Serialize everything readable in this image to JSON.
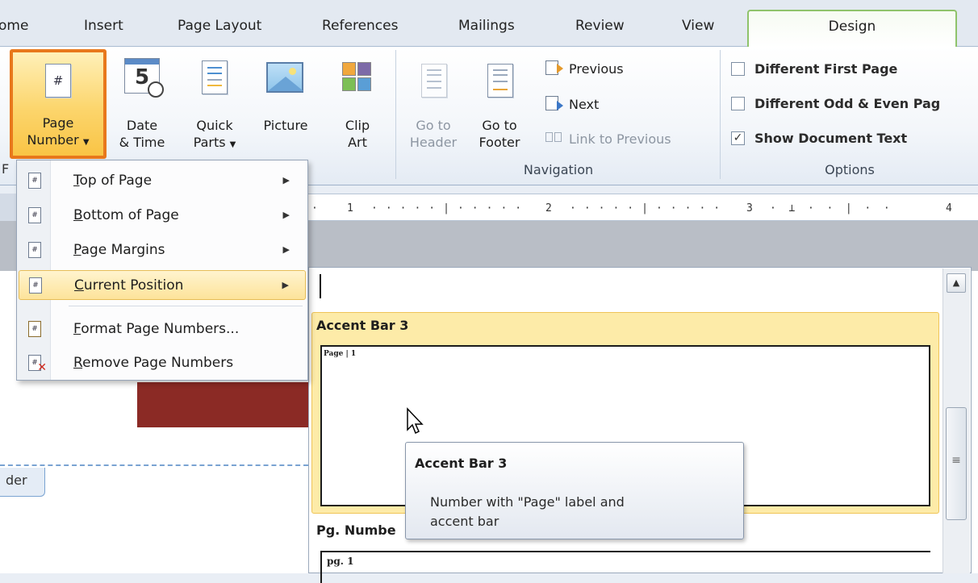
{
  "tabs": {
    "home": "ome",
    "insert": "Insert",
    "page_layout": "Page Layout",
    "references": "References",
    "mailings": "Mailings",
    "review": "Review",
    "view": "View",
    "design": "Design"
  },
  "ribbon": {
    "page_number": {
      "line1": "Page",
      "line2": "Number",
      "icon": "#"
    },
    "date_time": {
      "line1": "Date",
      "line2": "& Time",
      "icon_digit": "5"
    },
    "quick_parts": {
      "line1": "Quick",
      "line2": "Parts"
    },
    "picture": {
      "line1": "Picture"
    },
    "clip_art": {
      "line1": "Clip",
      "line2": "Art"
    },
    "goto_header": {
      "line1": "Go to",
      "line2": "Header"
    },
    "goto_footer": {
      "line1": "Go to",
      "line2": "Footer"
    },
    "previous": "Previous",
    "next": "Next",
    "link_to_previous": "Link to Previous",
    "navigation_group": "Navigation",
    "different_first_page": "Different First Page",
    "different_odd_even": "Different Odd & Even Pag",
    "show_document_text": "Show Document Text",
    "options_group": "Options",
    "left_edge_char": "F"
  },
  "menu": {
    "items": [
      {
        "label": "Top of Page",
        "mnemonic": "T",
        "rest": "op of Page"
      },
      {
        "label": "Bottom of Page",
        "mnemonic": "B",
        "rest": "ottom of Page"
      },
      {
        "label": "Page Margins",
        "mnemonic": "P",
        "rest": "age Margins"
      },
      {
        "label": "Current Position",
        "mnemonic": "C",
        "rest": "urrent Position"
      },
      {
        "label": "Format Page Numbers...",
        "mnemonic": "F",
        "rest": "ormat Page Numbers..."
      },
      {
        "label": "Remove Page Numbers",
        "mnemonic": "R",
        "rest": "emove Page Numbers"
      }
    ]
  },
  "ruler": {
    "marks": [
      "1",
      "2",
      "3",
      "4"
    ]
  },
  "gallery": {
    "item1_title": "Accent Bar 3",
    "item1_preview": "Page | 1",
    "item2_title": "Pg. Numbe",
    "item2_preview": "pg. 1"
  },
  "tooltip": {
    "title": "Accent Bar 3",
    "desc_line1": "Number with \"Page\" label and",
    "desc_line2": "accent bar"
  },
  "header_tab": "der",
  "colors": {
    "highlight_border": "#e8781c",
    "design_tab_border": "#8fc36b",
    "dark_red_bar": "#8b2a25",
    "menu_highlight": "#fde39a"
  }
}
